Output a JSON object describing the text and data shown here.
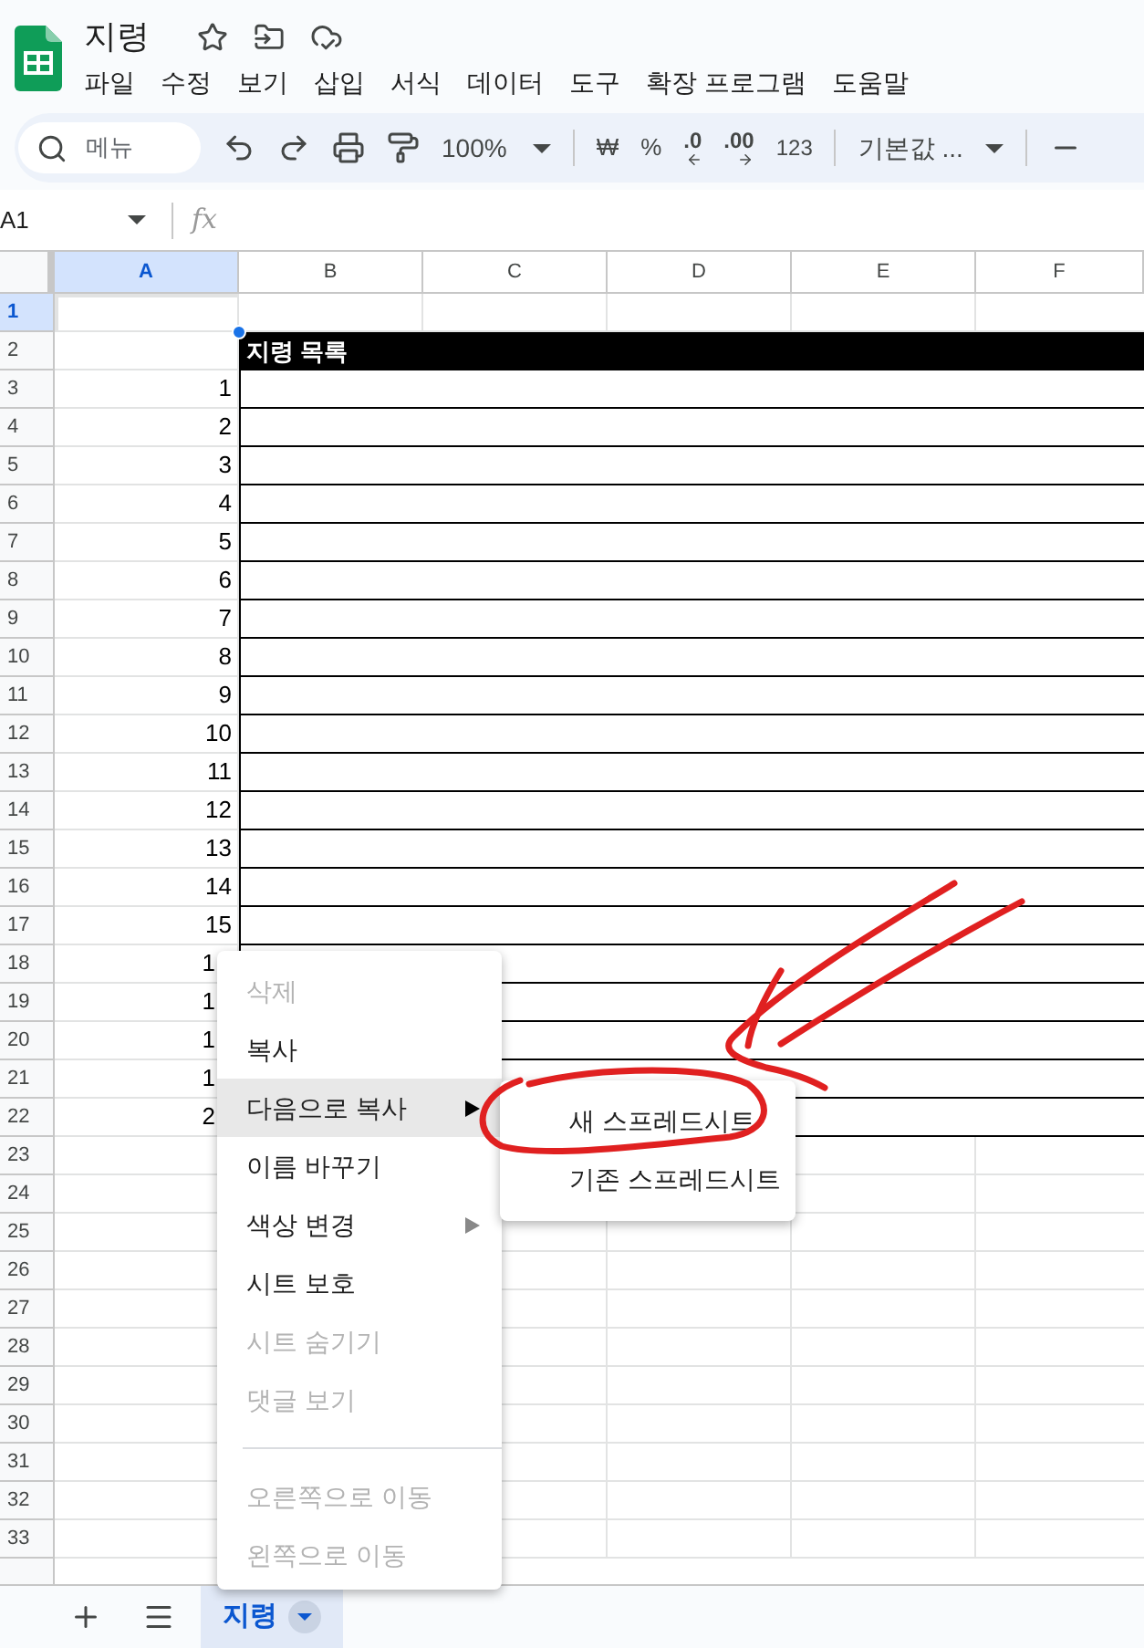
{
  "app": {
    "title": "지령",
    "menu": [
      "파일",
      "수정",
      "보기",
      "삽입",
      "서식",
      "데이터",
      "도구",
      "확장 프로그램",
      "도움말"
    ]
  },
  "toolbar": {
    "search_placeholder": "메뉴",
    "zoom": "100%",
    "currency": "₩",
    "percent": "%",
    "decrease_decimal": ".0",
    "increase_decimal": ".00",
    "number_format": "123",
    "font": "기본값 ..."
  },
  "formula_bar": {
    "cell_ref": "A1",
    "fx": "fx"
  },
  "columns": [
    {
      "label": "A",
      "selected": true
    },
    {
      "label": "B",
      "selected": false
    },
    {
      "label": "C",
      "selected": false
    },
    {
      "label": "D",
      "selected": false
    },
    {
      "label": "E",
      "selected": false
    },
    {
      "label": "F",
      "selected": false
    }
  ],
  "rows": [
    {
      "number": "1",
      "selected": true,
      "kind": "blank"
    },
    {
      "number": "2",
      "selected": false,
      "kind": "table_header",
      "title": "지령 목록"
    },
    {
      "number": "3",
      "selected": false,
      "kind": "table_row",
      "value": "1"
    },
    {
      "number": "4",
      "selected": false,
      "kind": "table_row",
      "value": "2"
    },
    {
      "number": "5",
      "selected": false,
      "kind": "table_row",
      "value": "3"
    },
    {
      "number": "6",
      "selected": false,
      "kind": "table_row",
      "value": "4"
    },
    {
      "number": "7",
      "selected": false,
      "kind": "table_row",
      "value": "5"
    },
    {
      "number": "8",
      "selected": false,
      "kind": "table_row",
      "value": "6"
    },
    {
      "number": "9",
      "selected": false,
      "kind": "table_row",
      "value": "7"
    },
    {
      "number": "10",
      "selected": false,
      "kind": "table_row",
      "value": "8"
    },
    {
      "number": "11",
      "selected": false,
      "kind": "table_row",
      "value": "9"
    },
    {
      "number": "12",
      "selected": false,
      "kind": "table_row",
      "value": "10"
    },
    {
      "number": "13",
      "selected": false,
      "kind": "table_row",
      "value": "11"
    },
    {
      "number": "14",
      "selected": false,
      "kind": "table_row",
      "value": "12"
    },
    {
      "number": "15",
      "selected": false,
      "kind": "table_row",
      "value": "13"
    },
    {
      "number": "16",
      "selected": false,
      "kind": "table_row",
      "value": "14"
    },
    {
      "number": "17",
      "selected": false,
      "kind": "table_row",
      "value": "15"
    },
    {
      "number": "18",
      "selected": false,
      "kind": "table_row",
      "value": "1",
      "cut": true
    },
    {
      "number": "19",
      "selected": false,
      "kind": "table_row",
      "value": "1",
      "cut": true
    },
    {
      "number": "20",
      "selected": false,
      "kind": "table_row",
      "value": "1",
      "cut": true
    },
    {
      "number": "21",
      "selected": false,
      "kind": "table_row",
      "value": "1",
      "cut": true
    },
    {
      "number": "22",
      "selected": false,
      "kind": "table_row",
      "value": "2",
      "cut": true
    },
    {
      "number": "23",
      "selected": false,
      "kind": "blank"
    },
    {
      "number": "24",
      "selected": false,
      "kind": "blank"
    },
    {
      "number": "25",
      "selected": false,
      "kind": "blank"
    },
    {
      "number": "26",
      "selected": false,
      "kind": "blank"
    },
    {
      "number": "27",
      "selected": false,
      "kind": "blank"
    },
    {
      "number": "28",
      "selected": false,
      "kind": "blank"
    },
    {
      "number": "29",
      "selected": false,
      "kind": "blank"
    },
    {
      "number": "30",
      "selected": false,
      "kind": "blank"
    },
    {
      "number": "31",
      "selected": false,
      "kind": "blank"
    },
    {
      "number": "32",
      "selected": false,
      "kind": "blank"
    },
    {
      "number": "33",
      "selected": false,
      "kind": "blank"
    }
  ],
  "context_menu": [
    {
      "kind": "item",
      "label": "삭제",
      "disabled": true,
      "selected": false,
      "submenu": false
    },
    {
      "kind": "item",
      "label": "복사",
      "disabled": false,
      "selected": false,
      "submenu": false
    },
    {
      "kind": "item",
      "label": "다음으로 복사",
      "disabled": false,
      "selected": true,
      "submenu": true
    },
    {
      "kind": "item",
      "label": "이름 바꾸기",
      "disabled": false,
      "selected": false,
      "submenu": false
    },
    {
      "kind": "item",
      "label": "색상 변경",
      "disabled": false,
      "selected": false,
      "submenu": true
    },
    {
      "kind": "item",
      "label": "시트 보호",
      "disabled": false,
      "selected": false,
      "submenu": false
    },
    {
      "kind": "item",
      "label": "시트 숨기기",
      "disabled": true,
      "selected": false,
      "submenu": false
    },
    {
      "kind": "item",
      "label": "댓글 보기",
      "disabled": true,
      "selected": false,
      "submenu": false
    },
    {
      "kind": "divider"
    },
    {
      "kind": "item",
      "label": "오른쪽으로 이동",
      "disabled": true,
      "selected": false,
      "submenu": false
    },
    {
      "kind": "item",
      "label": "왼쪽으로 이동",
      "disabled": true,
      "selected": false,
      "submenu": false
    }
  ],
  "submenu": [
    {
      "label": "새 스프레드시트"
    },
    {
      "label": "기존 스프레드시트"
    }
  ],
  "sheet_tabs": [
    {
      "label": "지령",
      "selected": true
    }
  ]
}
